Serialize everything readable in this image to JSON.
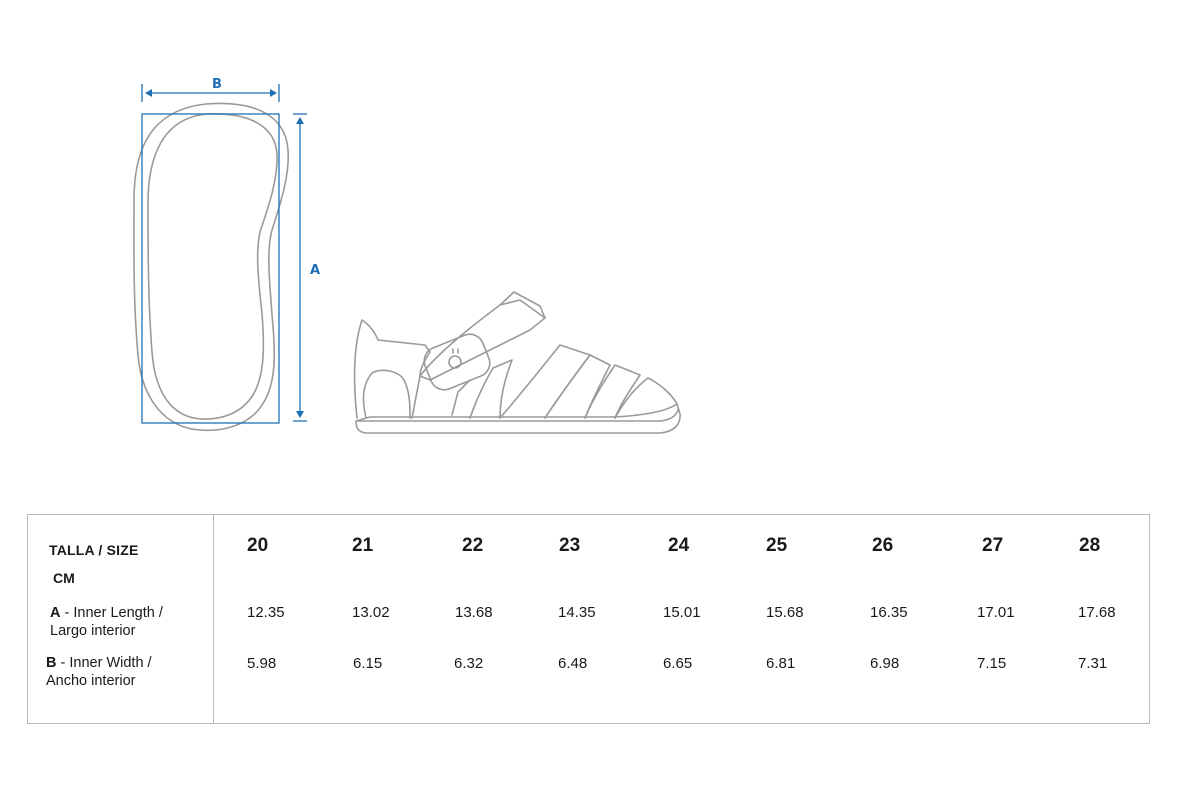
{
  "diagram": {
    "width_label": "B",
    "length_label": "A",
    "colors": {
      "dimension_blue": "#1f6fb5",
      "outline_gray": "#9a9a9a"
    }
  },
  "table": {
    "header_label": "TALLA / SIZE",
    "unit_label": "CM",
    "row_a": {
      "key": "A",
      "label_line1": " -  Inner Length /",
      "label_line2": "Largo interior"
    },
    "row_b": {
      "key": "B",
      "label_line1": " -  Inner Width /",
      "label_line2": "Ancho interior"
    },
    "sizes": [
      "20",
      "21",
      "22",
      "23",
      "24",
      "25",
      "26",
      "27",
      "28"
    ],
    "inner_length_cm": [
      "12.35",
      "13.02",
      "13.68",
      "14.35",
      "15.01",
      "15.68",
      "16.35",
      "17.01",
      "17.68"
    ],
    "inner_width_cm": [
      "5.98",
      "6.15",
      "6.32",
      "6.48",
      "6.65",
      "6.81",
      "6.98",
      "7.15",
      "7.31"
    ]
  }
}
